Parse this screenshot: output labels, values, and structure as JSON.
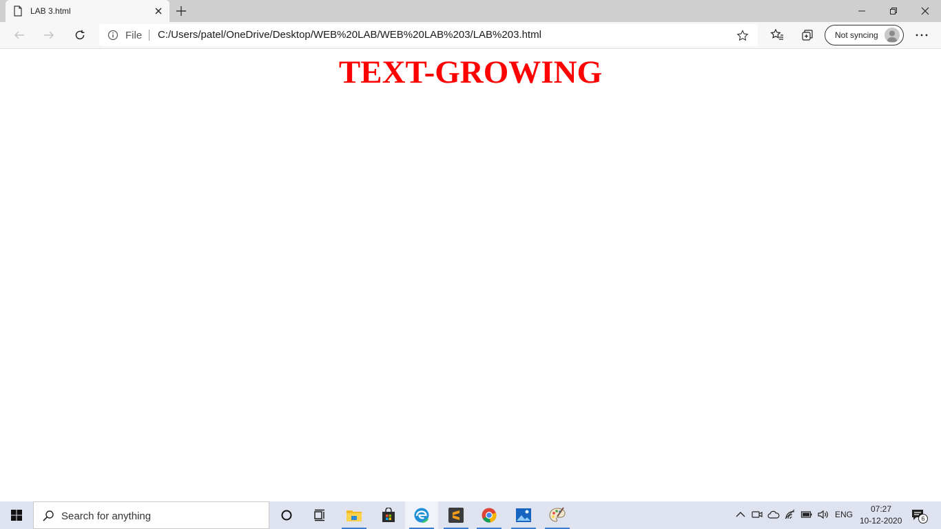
{
  "browser": {
    "tab": {
      "title": "LAB 3.html",
      "icon": "document-icon"
    },
    "address": {
      "scheme_label": "File",
      "url": "C:/Users/patel/OneDrive/Desktop/WEB%20LAB/WEB%20LAB%203/LAB%203.html"
    },
    "profile": {
      "label": "Not syncing"
    }
  },
  "page": {
    "heading": "TEXT-GROWING",
    "heading_color": "#ff0000"
  },
  "taskbar": {
    "search_placeholder": "Search for anything",
    "apps": [
      "cortana",
      "task-view",
      "file-explorer",
      "store",
      "edge",
      "sublime-text",
      "chrome",
      "photos",
      "paint"
    ],
    "tray": {
      "language": "ENG",
      "time": "07:27",
      "date": "10-12-2020",
      "notification_count": "6"
    }
  }
}
